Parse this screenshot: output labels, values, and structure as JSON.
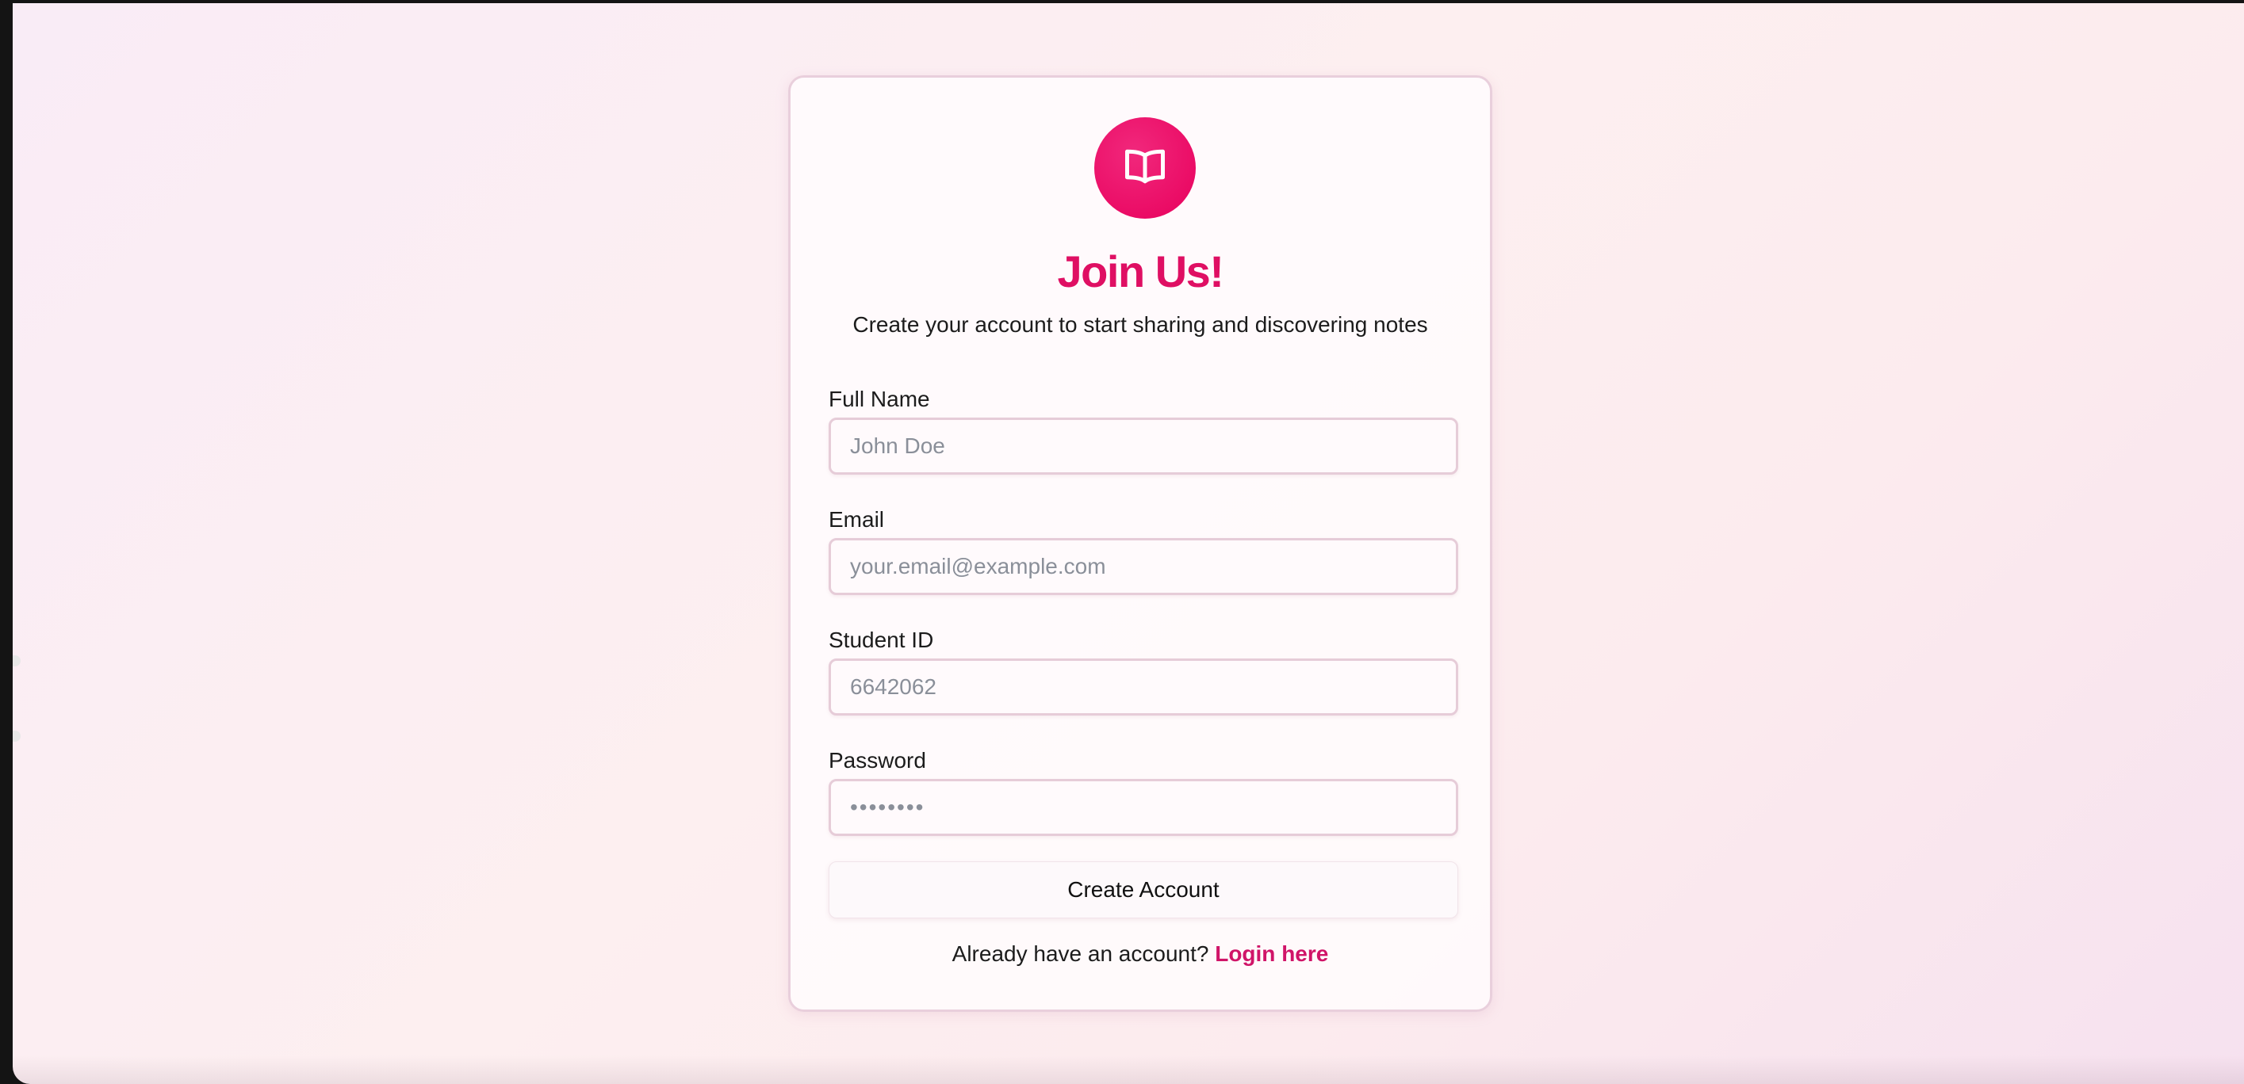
{
  "brand": {
    "icon": "open-book-icon",
    "accent_color": "#e8005c",
    "title_color": "#df0f63"
  },
  "header": {
    "title": "Join Us!",
    "subtitle": "Create your account to start sharing and discovering notes"
  },
  "form": {
    "full_name": {
      "label": "Full Name",
      "placeholder": "John Doe",
      "value": ""
    },
    "email": {
      "label": "Email",
      "placeholder": "your.email@example.com",
      "value": ""
    },
    "student_id": {
      "label": "Student ID",
      "placeholder": "6642062",
      "value": ""
    },
    "password": {
      "label": "Password",
      "placeholder": "••••••••",
      "value": ""
    },
    "submit_label": "Create Account"
  },
  "footer": {
    "prompt": "Already have an account?",
    "link_label": "Login here",
    "link_color": "#d01468"
  }
}
